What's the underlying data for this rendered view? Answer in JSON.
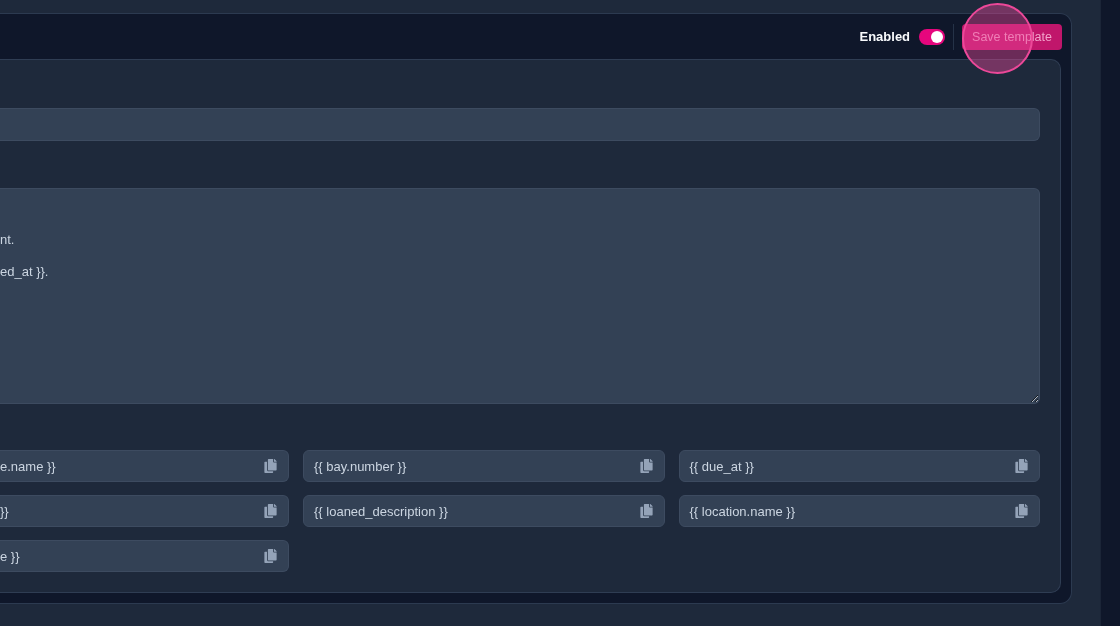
{
  "header": {
    "toggle": {
      "label": "Enabled",
      "on": true
    },
    "save_button": {
      "label": "Save template",
      "disabled": true
    }
  },
  "message_field": {
    "value": "nt.\n\ned_at }}."
  },
  "variables": [
    "e.name }}",
    "{{ bay.number }}",
    "{{ due_at }}",
    "}}",
    "{{ loaned_description }}",
    "{{ location.name }}",
    "e }}"
  ]
}
